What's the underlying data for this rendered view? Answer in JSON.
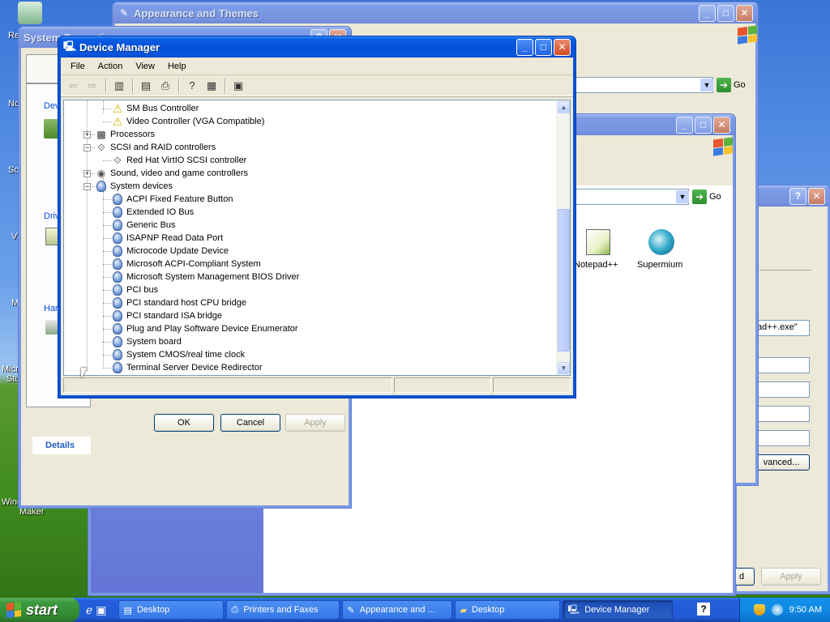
{
  "desktop": {
    "left_labels": [
      "Re",
      "No",
      "Sc",
      "Vi",
      "M",
      "Micr",
      "Stu",
      "Wind",
      "Maker"
    ]
  },
  "windows": {
    "appearance": {
      "title": "Appearance and Themes",
      "go_label": "Go"
    },
    "system_properties": {
      "title": "System Properties",
      "group_labels": [
        "Dev",
        "Driv",
        "Har"
      ],
      "ok_label": "OK",
      "cancel_label": "Cancel",
      "apply_label": "Apply",
      "details_label": "Details"
    },
    "folder_window": {
      "go_label": "Go",
      "icons": [
        {
          "label": "Notepad++",
          "icon": "notepad-plus-plus-icon"
        },
        {
          "label": "Supermium",
          "icon": "supermium-browser-icon"
        }
      ]
    },
    "properties_right": {
      "field_value": "ad++.exe\"",
      "advanced_label": "vanced...",
      "apply_label": "Apply",
      "ok_partial": "d"
    }
  },
  "device_manager": {
    "title": "Device Manager",
    "menu": [
      "File",
      "Action",
      "View",
      "Help"
    ],
    "toolbar": [
      {
        "name": "back-icon",
        "glyph": "⇦",
        "disabled": true
      },
      {
        "name": "forward-icon",
        "glyph": "⇨",
        "disabled": true
      },
      {
        "name": "show-hide-console-tree-icon",
        "glyph": "▥"
      },
      {
        "name": "properties-icon",
        "glyph": "▤"
      },
      {
        "name": "print-icon",
        "glyph": "⎙"
      },
      {
        "name": "help-icon",
        "glyph": "?"
      },
      {
        "name": "show-hide-action-pane-icon",
        "glyph": "▦"
      },
      {
        "name": "scan-hardware-changes-icon",
        "glyph": "▣"
      }
    ],
    "tree": [
      {
        "level": 2,
        "label": "SM Bus Controller",
        "icon": "warning"
      },
      {
        "level": 2,
        "label": "Video Controller (VGA Compatible)",
        "icon": "warning"
      },
      {
        "level": 1,
        "label": "Processors",
        "icon": "chip",
        "expander": "+"
      },
      {
        "level": 1,
        "label": "SCSI and RAID controllers",
        "icon": "scsi",
        "expander": "−"
      },
      {
        "level": 2,
        "label": "Red Hat VirtIO SCSI controller",
        "icon": "scsi"
      },
      {
        "level": 1,
        "label": "Sound, video and game controllers",
        "icon": "sound",
        "expander": "+"
      },
      {
        "level": 1,
        "label": "System devices",
        "icon": "sys",
        "expander": "−"
      },
      {
        "level": 2,
        "label": "ACPI Fixed Feature Button",
        "icon": "sys"
      },
      {
        "level": 2,
        "label": "Extended IO Bus",
        "icon": "sys"
      },
      {
        "level": 2,
        "label": "Generic Bus",
        "icon": "sys"
      },
      {
        "level": 2,
        "label": "ISAPNP Read Data Port",
        "icon": "sys"
      },
      {
        "level": 2,
        "label": "Microcode Update Device",
        "icon": "sys"
      },
      {
        "level": 2,
        "label": "Microsoft ACPI-Compliant System",
        "icon": "sys"
      },
      {
        "level": 2,
        "label": "Microsoft System Management BIOS Driver",
        "icon": "sys"
      },
      {
        "level": 2,
        "label": "PCI bus",
        "icon": "sys"
      },
      {
        "level": 2,
        "label": "PCI standard host CPU bridge",
        "icon": "sys"
      },
      {
        "level": 2,
        "label": "PCI standard ISA bridge",
        "icon": "sys"
      },
      {
        "level": 2,
        "label": "Plug and Play Software Device Enumerator",
        "icon": "sys"
      },
      {
        "level": 2,
        "label": "System board",
        "icon": "sys"
      },
      {
        "level": 2,
        "label": "System CMOS/real time clock",
        "icon": "sys"
      },
      {
        "level": 2,
        "label": "Terminal Server Device Redirector",
        "icon": "sys"
      }
    ]
  },
  "taskbar": {
    "start_label": "start",
    "tasks": [
      {
        "label": "Desktop",
        "icon": "desktop-icon",
        "active": false
      },
      {
        "label": "Printers and Faxes",
        "icon": "printer-icon",
        "active": false
      },
      {
        "label": "Appearance and ...",
        "icon": "control-panel-icon",
        "active": false
      },
      {
        "label": "Desktop",
        "icon": "folder-icon",
        "active": false
      },
      {
        "label": "Device Manager",
        "icon": "device-manager-icon",
        "active": true
      }
    ],
    "clock": "9:50 AM"
  }
}
